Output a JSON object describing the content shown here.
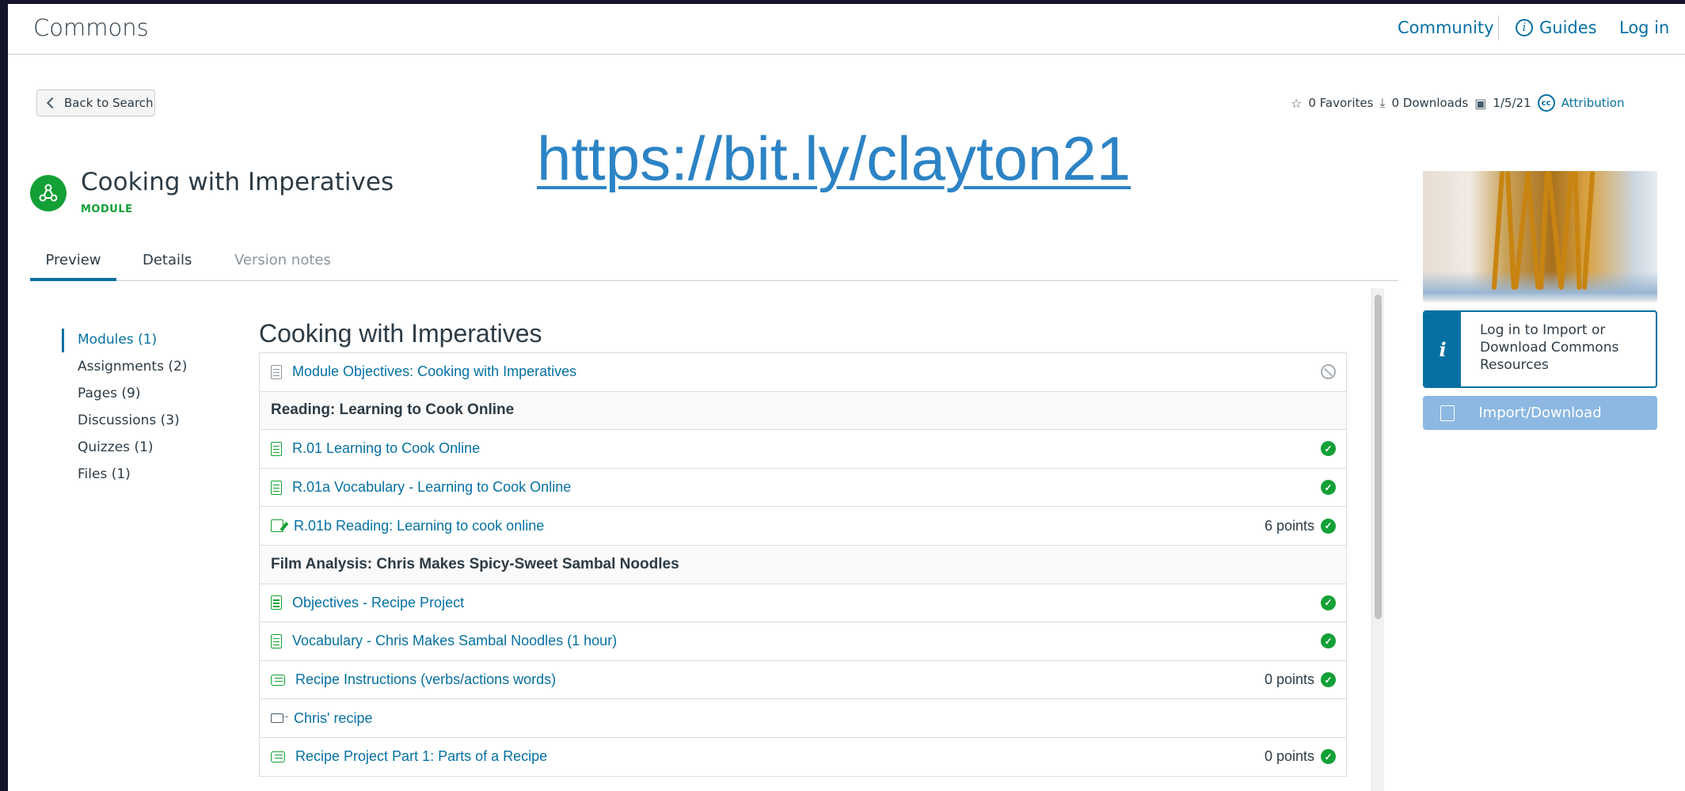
{
  "header": {
    "brand": "Commons",
    "community": "Community",
    "guides": "Guides",
    "login": "Log in"
  },
  "back_label": "Back to Search",
  "stats": {
    "favorites": "0 Favorites",
    "downloads": "0 Downloads",
    "date": "1/5/21",
    "attribution": "Attribution"
  },
  "overlay_link": "https://bit.ly/clayton21",
  "resource": {
    "title": "Cooking with Imperatives",
    "type": "MODULE"
  },
  "tabs": [
    "Preview",
    "Details",
    "Version notes"
  ],
  "sidebar": {
    "items": [
      {
        "label": "Modules (1)"
      },
      {
        "label": "Assignments (2)"
      },
      {
        "label": "Pages (9)"
      },
      {
        "label": "Discussions (3)"
      },
      {
        "label": "Quizzes (1)"
      },
      {
        "label": "Files (1)"
      }
    ]
  },
  "content": {
    "title": "Cooking with Imperatives",
    "rows": [
      {
        "kind": "page-grey",
        "label": "Module Objectives: Cooking with Imperatives",
        "points": "",
        "status": "none"
      },
      {
        "kind": "header",
        "label": "Reading: Learning to Cook Online",
        "points": "",
        "status": ""
      },
      {
        "kind": "page",
        "label": "R.01 Learning to Cook Online",
        "points": "",
        "status": "check"
      },
      {
        "kind": "page",
        "label": "R.01a Vocabulary - Learning to Cook Online",
        "points": "",
        "status": "check"
      },
      {
        "kind": "assignment",
        "label": "R.01b Reading: Learning to cook online",
        "points": "6 points",
        "status": "check"
      },
      {
        "kind": "header",
        "label": "Film Analysis: Chris Makes Spicy-Sweet Sambal Noodles",
        "points": "",
        "status": ""
      },
      {
        "kind": "page",
        "label": "Objectives - Recipe Project",
        "points": "",
        "status": "check"
      },
      {
        "kind": "page",
        "label": "Vocabulary - Chris Makes Sambal Noodles (1 hour)",
        "points": "",
        "status": "check"
      },
      {
        "kind": "discussion",
        "label": "Recipe Instructions (verbs/actions words)",
        "points": "0 points",
        "status": "check"
      },
      {
        "kind": "external",
        "label": "Chris' recipe",
        "points": "",
        "status": ""
      },
      {
        "kind": "discussion",
        "label": "Recipe Project Part 1: Parts of a Recipe",
        "points": "0 points",
        "status": "check"
      }
    ]
  },
  "panel": {
    "login_text": "Log in to Import or Download Commons Resources",
    "import_label": "Import/Download",
    "info_glyph": "i"
  },
  "colors": {
    "accent": "#0770a3",
    "module_green": "#13a036",
    "link_overlay": "#2c83c5",
    "background_frame": "#14152b"
  }
}
